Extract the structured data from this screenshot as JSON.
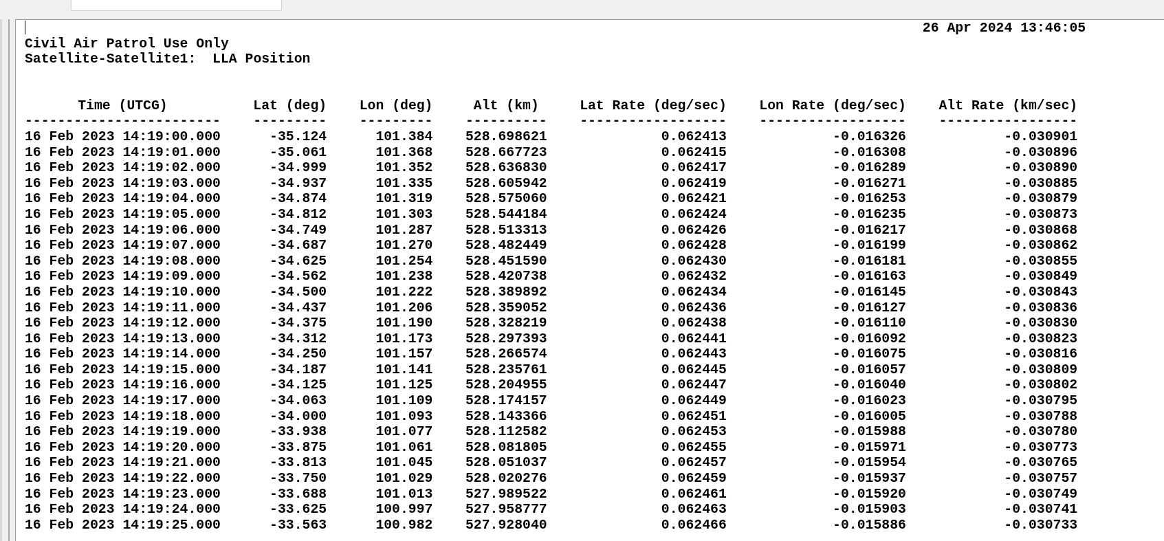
{
  "report": {
    "timestamp": "26 Apr 2024 13:46:05",
    "title_lines": [
      "Civil Air Patrol Use Only",
      "Satellite-Satellite1:  LLA Position"
    ],
    "columns": [
      {
        "label": "Time (UTCG)",
        "rule": "------------------------"
      },
      {
        "label": "Lat (deg)",
        "rule": "---------"
      },
      {
        "label": "Lon (deg)",
        "rule": "---------"
      },
      {
        "label": "Alt (km)",
        "rule": "----------"
      },
      {
        "label": "Lat Rate (deg/sec)",
        "rule": "------------------"
      },
      {
        "label": "Lon Rate (deg/sec)",
        "rule": "------------------"
      },
      {
        "label": "Alt Rate (km/sec)",
        "rule": "-----------------"
      }
    ],
    "rows": [
      [
        "16 Feb 2023 14:19:00.000",
        "-35.124",
        "101.384",
        "528.698621",
        "0.062413",
        "-0.016326",
        "-0.030901"
      ],
      [
        "16 Feb 2023 14:19:01.000",
        "-35.061",
        "101.368",
        "528.667723",
        "0.062415",
        "-0.016308",
        "-0.030896"
      ],
      [
        "16 Feb 2023 14:19:02.000",
        "-34.999",
        "101.352",
        "528.636830",
        "0.062417",
        "-0.016289",
        "-0.030890"
      ],
      [
        "16 Feb 2023 14:19:03.000",
        "-34.937",
        "101.335",
        "528.605942",
        "0.062419",
        "-0.016271",
        "-0.030885"
      ],
      [
        "16 Feb 2023 14:19:04.000",
        "-34.874",
        "101.319",
        "528.575060",
        "0.062421",
        "-0.016253",
        "-0.030879"
      ],
      [
        "16 Feb 2023 14:19:05.000",
        "-34.812",
        "101.303",
        "528.544184",
        "0.062424",
        "-0.016235",
        "-0.030873"
      ],
      [
        "16 Feb 2023 14:19:06.000",
        "-34.749",
        "101.287",
        "528.513313",
        "0.062426",
        "-0.016217",
        "-0.030868"
      ],
      [
        "16 Feb 2023 14:19:07.000",
        "-34.687",
        "101.270",
        "528.482449",
        "0.062428",
        "-0.016199",
        "-0.030862"
      ],
      [
        "16 Feb 2023 14:19:08.000",
        "-34.625",
        "101.254",
        "528.451590",
        "0.062430",
        "-0.016181",
        "-0.030855"
      ],
      [
        "16 Feb 2023 14:19:09.000",
        "-34.562",
        "101.238",
        "528.420738",
        "0.062432",
        "-0.016163",
        "-0.030849"
      ],
      [
        "16 Feb 2023 14:19:10.000",
        "-34.500",
        "101.222",
        "528.389892",
        "0.062434",
        "-0.016145",
        "-0.030843"
      ],
      [
        "16 Feb 2023 14:19:11.000",
        "-34.437",
        "101.206",
        "528.359052",
        "0.062436",
        "-0.016127",
        "-0.030836"
      ],
      [
        "16 Feb 2023 14:19:12.000",
        "-34.375",
        "101.190",
        "528.328219",
        "0.062438",
        "-0.016110",
        "-0.030830"
      ],
      [
        "16 Feb 2023 14:19:13.000",
        "-34.312",
        "101.173",
        "528.297393",
        "0.062441",
        "-0.016092",
        "-0.030823"
      ],
      [
        "16 Feb 2023 14:19:14.000",
        "-34.250",
        "101.157",
        "528.266574",
        "0.062443",
        "-0.016075",
        "-0.030816"
      ],
      [
        "16 Feb 2023 14:19:15.000",
        "-34.187",
        "101.141",
        "528.235761",
        "0.062445",
        "-0.016057",
        "-0.030809"
      ],
      [
        "16 Feb 2023 14:19:16.000",
        "-34.125",
        "101.125",
        "528.204955",
        "0.062447",
        "-0.016040",
        "-0.030802"
      ],
      [
        "16 Feb 2023 14:19:17.000",
        "-34.063",
        "101.109",
        "528.174157",
        "0.062449",
        "-0.016023",
        "-0.030795"
      ],
      [
        "16 Feb 2023 14:19:18.000",
        "-34.000",
        "101.093",
        "528.143366",
        "0.062451",
        "-0.016005",
        "-0.030788"
      ],
      [
        "16 Feb 2023 14:19:19.000",
        "-33.938",
        "101.077",
        "528.112582",
        "0.062453",
        "-0.015988",
        "-0.030780"
      ],
      [
        "16 Feb 2023 14:19:20.000",
        "-33.875",
        "101.061",
        "528.081805",
        "0.062455",
        "-0.015971",
        "-0.030773"
      ],
      [
        "16 Feb 2023 14:19:21.000",
        "-33.813",
        "101.045",
        "528.051037",
        "0.062457",
        "-0.015954",
        "-0.030765"
      ],
      [
        "16 Feb 2023 14:19:22.000",
        "-33.750",
        "101.029",
        "528.020276",
        "0.062459",
        "-0.015937",
        "-0.030757"
      ],
      [
        "16 Feb 2023 14:19:23.000",
        "-33.688",
        "101.013",
        "527.989522",
        "0.062461",
        "-0.015920",
        "-0.030749"
      ],
      [
        "16 Feb 2023 14:19:24.000",
        "-33.625",
        "100.997",
        "527.958777",
        "0.062463",
        "-0.015903",
        "-0.030741"
      ],
      [
        "16 Feb 2023 14:19:25.000",
        "-33.563",
        "100.982",
        "527.928040",
        "0.062466",
        "-0.015886",
        "-0.030733"
      ]
    ]
  }
}
